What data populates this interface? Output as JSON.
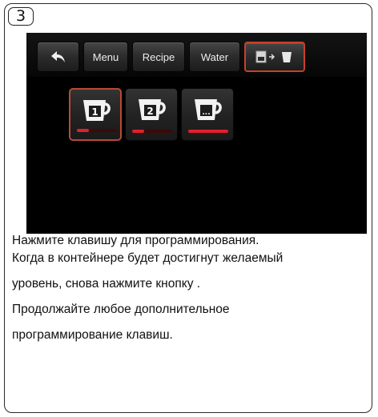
{
  "step_number": "3",
  "nav": {
    "back_icon": "back-arrow-icon",
    "menu_label": "Menu",
    "recipe_label": "Recipe",
    "water_label": "Water",
    "fill_icon": "container-fill-icon"
  },
  "keys": [
    {
      "label": "1",
      "icon": "cup-icon",
      "level": 0.3,
      "selected": true
    },
    {
      "label": "2",
      "icon": "cup-icon",
      "level": 0.3,
      "selected": false
    },
    {
      "label": "...",
      "icon": "cup-icon",
      "level": 1.0,
      "selected": false
    }
  ],
  "instructions": {
    "line1": "Нажмите клавишу для программирования.",
    "line2": "Когда в контейнере будет достигнут желаемый",
    "line3": "уровень, снова нажмите кнопку .",
    "line4": "Продолжайте любое дополнительное",
    "line5": "программирование клавиш."
  },
  "colors": {
    "accent": "#c8402c",
    "level_bar": "#e3202a",
    "screen_bg": "#000000"
  }
}
